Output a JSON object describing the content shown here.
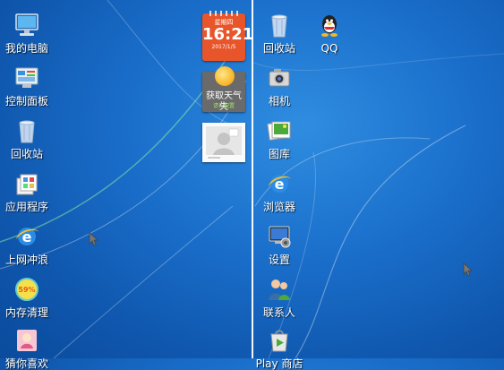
{
  "desktop": {
    "left_icons": [
      {
        "label": "我的电脑",
        "icon": "computer-icon"
      },
      {
        "label": "控制面板",
        "icon": "control-panel-icon"
      },
      {
        "label": "回收站",
        "icon": "recycle-bin-icon"
      },
      {
        "label": "应用程序",
        "icon": "applications-icon"
      },
      {
        "label": "上网冲浪",
        "icon": "ie-browser-icon"
      },
      {
        "label": "内存清理",
        "icon": "memory-clean-icon"
      },
      {
        "label": "猜你喜欢",
        "icon": "recommend-icon"
      }
    ],
    "right_icons_col1": [
      {
        "label": "回收站",
        "icon": "recycle-bin-icon"
      },
      {
        "label": "相机",
        "icon": "camera-icon"
      },
      {
        "label": "图库",
        "icon": "gallery-icon"
      },
      {
        "label": "浏览器",
        "icon": "ie-browser-icon"
      },
      {
        "label": "设置",
        "icon": "settings-icon"
      },
      {
        "label": "联系人",
        "icon": "contacts-icon"
      },
      {
        "label": "Play 商店",
        "icon": "play-store-icon"
      }
    ],
    "right_icons_col2": [
      {
        "label": "QQ",
        "icon": "qq-icon"
      }
    ],
    "memory_badge": "59%"
  },
  "widgets": {
    "clock": {
      "weekday": "星期四",
      "time": "16:21",
      "date": "2017/1/5"
    },
    "weather": {
      "title": "获取天气失",
      "subtitle": "请先配置"
    }
  },
  "colors": {
    "wallpaper": "#1a6fcb",
    "clock_widget": "#e8552a",
    "weather_widget": "#6a6a6a"
  }
}
